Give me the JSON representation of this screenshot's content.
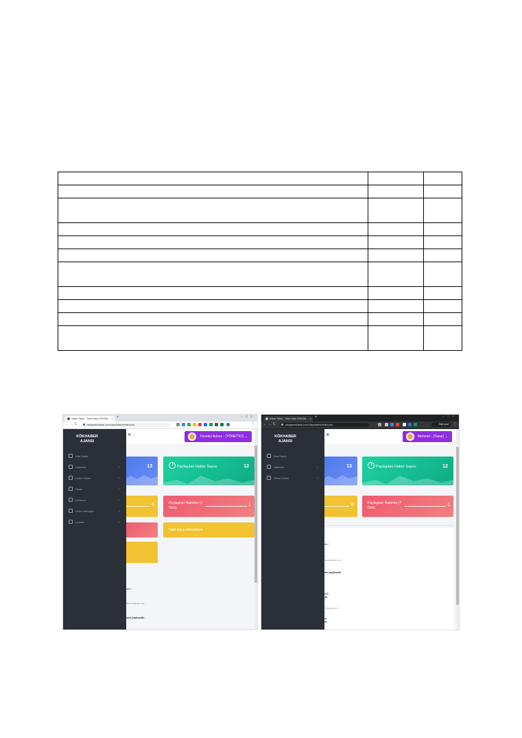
{
  "table": {
    "rows": 12,
    "cols": 3
  },
  "left_screenshot": {
    "tab_title": "Haber Sitesi - Taha Yasin KÖKSAL",
    "url": "tahayasinkoksal.com.tr/php/admin/index.php",
    "brand_line1": "KÖKHABER",
    "brand_line2": "AJANSI",
    "user_label": "Yönetici Adınız - (YÖNETİCİ)",
    "sidebar_items": [
      "Ana Sayfa",
      "Haberler",
      "Video Haber",
      "Slider",
      "Kullanıcı",
      "Gelen Mesajlar",
      "Ayarlar"
    ],
    "card_top_count": "13",
    "card_shared_label": "Paylaşılan Haber Sayısı",
    "card_shared_count": "12",
    "card_small_count": "6",
    "card_7day_label": "Paylaşılan Haberler (7 Gün)",
    "card_7day_count": "1",
    "card_new_user": "YENİ KULLANICI EKLE",
    "bottom_lines": [
      "arts !",
      "ünde kullanılan eng...",
      "dan paylaşıldı"
    ]
  },
  "right_screenshot": {
    "tab_title": "Haber Sitesi - Taha Yasin KÖKSAL",
    "url": "tahayasinkoksal.com.tr/php/admin/index.php",
    "profile": "Gizli mod",
    "brand_line1": "KÖKHABER",
    "brand_line2": "AJANSI",
    "user_label": "Mehmet - (Yazar)",
    "sidebar_items": [
      "Ana Sayfa",
      "Haberler",
      "Video Haber"
    ],
    "card_top_count": "13",
    "card_shared_label": "Paylaşılan Haber Sayısı",
    "card_shared_count": "12",
    "card_small_count": "6",
    "card_7day_label": "Paylaşılan Haberler (7 Gün)",
    "card_7day_count": "1",
    "bottom_lines": [
      "arts !",
      "ünde kullanılan eng...",
      "dan paylaşıldı",
      "ı 4.0",
      "ıldı",
      "ürü Süleyman S...",
      "ası",
      "ıldı"
    ]
  },
  "colors": {
    "sidebar": "#2b2f38",
    "user_button": "#8e2de2",
    "blue_card": "#4b7bec",
    "green_card": "#1dd1a1",
    "yellow_card": "#f1c232",
    "red_card": "#ee5a6f"
  }
}
